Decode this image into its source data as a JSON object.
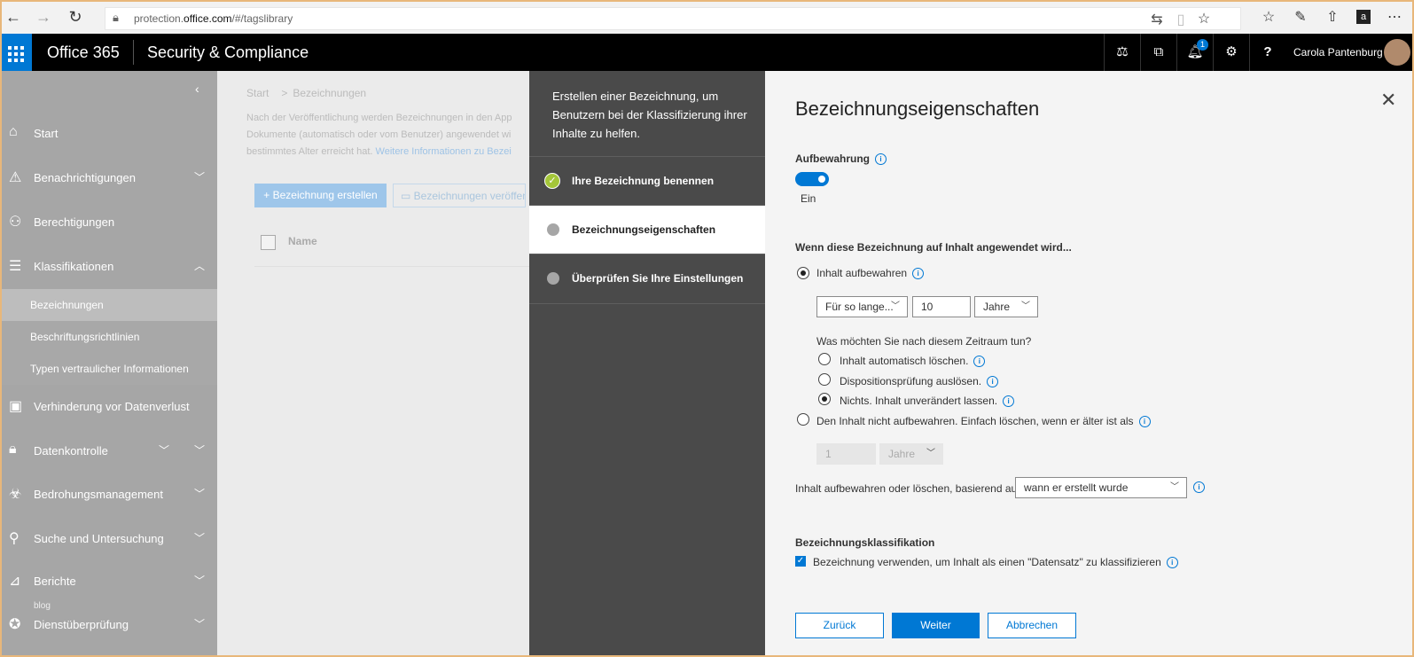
{
  "browser": {
    "url_prefix": "protection.",
    "url_host": "office.com",
    "url_path": "/#/tagslibrary"
  },
  "header": {
    "brand": "Office 365",
    "app": "Security & Compliance",
    "notification_count": "1",
    "user": "Carola Pantenburg"
  },
  "nav": {
    "items": [
      {
        "label": "Start",
        "icon": "home-icon"
      },
      {
        "label": "Benachrichtigungen",
        "icon": "alert-icon"
      },
      {
        "label": "Berechtigungen",
        "icon": "people-icon"
      },
      {
        "label": "Klassifikationen",
        "icon": "list-icon"
      },
      {
        "label": "Verhinderung vor Datenverlust",
        "icon": "lock-doc-icon"
      },
      {
        "label": "Datenkontrolle",
        "icon": "lock-icon"
      },
      {
        "label": "Bedrohungsmanagement",
        "icon": "biohazard-icon"
      },
      {
        "label": "Suche und Untersuchung",
        "icon": "search-icon"
      },
      {
        "label": "Berichte",
        "icon": "chart-icon"
      },
      {
        "label": "Dienstüberprüfung",
        "icon": "ribbon-icon"
      }
    ],
    "subitems": [
      "Bezeichnungen",
      "Beschriftungsrichtlinien",
      "Typen vertraulicher Informationen"
    ],
    "blog": "blog"
  },
  "page": {
    "crumb_start": "Start",
    "crumb_current": "Bezeichnungen",
    "desc_1": "Nach der Veröffentlichung werden Bezeichnungen in den App",
    "desc_2": "Dokumente (automatisch oder vom Benutzer) angewendet wi",
    "desc_3": "bestimmtes Alter erreicht hat.",
    "desc_link": "Weitere Informationen zu Bezei",
    "create_button": "Bezeichnung erstellen",
    "publish_button": "Bezeichnungen veröffent",
    "col_name": "Name"
  },
  "wizard": {
    "intro": "Erstellen einer Bezeichnung, um Benutzern bei der Klassifizierung ihrer Inhalte zu helfen.",
    "steps": [
      "Ihre Bezeichnung benennen",
      "Bezeichnungseigenschaften",
      "Überprüfen Sie Ihre Einstellungen"
    ]
  },
  "panel": {
    "title": "Bezeichnungseigenschaften",
    "retention_label": "Aufbewahrung",
    "toggle_state": "Ein",
    "apply_heading": "Wenn diese Bezeichnung auf Inhalt angewendet wird...",
    "keep_content": "Inhalt aufbewahren",
    "duration_select": "Für so lange...",
    "duration_value": "10",
    "duration_unit": "Jahre",
    "after_question": "Was möchten Sie nach diesem Zeitraum tun?",
    "opt_delete": "Inhalt automatisch löschen.",
    "opt_review": "Dispositionsprüfung auslösen.",
    "opt_nothing": "Nichts. Inhalt unverändert lassen.",
    "dont_keep": "Den Inhalt nicht aufbewahren. Einfach löschen, wenn er älter ist als",
    "delete_value": "1",
    "delete_unit": "Jahre",
    "based_on_label": "Inhalt aufbewahren oder löschen, basierend auf",
    "based_on_value": "wann er erstellt wurde",
    "classification_heading": "Bezeichnungsklassifikation",
    "record_checkbox": "Bezeichnung verwenden, um Inhalt als einen \"Datensatz\" zu klassifizieren",
    "back": "Zurück",
    "next": "Weiter",
    "cancel": "Abbrechen"
  },
  "colors": {
    "accent": "#0078d4",
    "nav_bg": "#a6a6a6",
    "wizard_bg": "#4a4a4a",
    "done_green": "#a4c639"
  }
}
